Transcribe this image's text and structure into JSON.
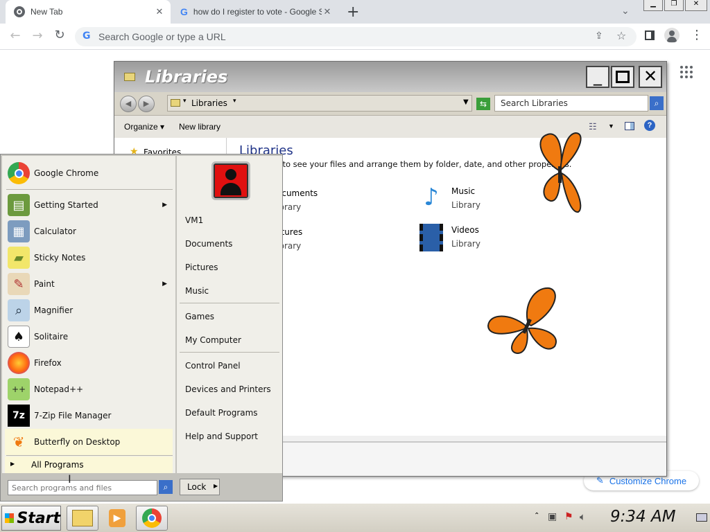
{
  "browser": {
    "tabs": [
      {
        "title": "New Tab",
        "active": true
      },
      {
        "title": "how do I register to vote - Google S",
        "active": false
      }
    ],
    "new_tab_symbol": "+",
    "omnibox_placeholder": "Search Google or type a URL",
    "customize_label": "Customize Chrome"
  },
  "explorer": {
    "title": "Libraries",
    "address": "Libraries",
    "search_placeholder": "Search Libraries",
    "toolbar": {
      "organize": "Organize",
      "new_library": "New library"
    },
    "nav_favorites": "Favorites",
    "heading": "Libraries",
    "description": "y to see your files and arrange them by folder, date, and other properties.",
    "libraries": [
      {
        "name": "ocuments",
        "type": "ibrary"
      },
      {
        "name": "Music",
        "type": "Library"
      },
      {
        "name": "ctures",
        "type": "ibrary"
      },
      {
        "name": "Videos",
        "type": "Library"
      }
    ]
  },
  "start_menu": {
    "left_items": [
      {
        "label": "Google Chrome",
        "icon": "chrome-icon",
        "submenu": false
      },
      {
        "label": "Getting Started",
        "icon": "getting-started-icon",
        "submenu": true
      },
      {
        "label": "Calculator",
        "icon": "calculator-icon",
        "submenu": false
      },
      {
        "label": "Sticky Notes",
        "icon": "sticky-notes-icon",
        "submenu": false
      },
      {
        "label": "Paint",
        "icon": "paint-icon",
        "submenu": true
      },
      {
        "label": "Magnifier",
        "icon": "magnifier-icon",
        "submenu": false
      },
      {
        "label": "Solitaire",
        "icon": "solitaire-icon",
        "submenu": false
      },
      {
        "label": "Firefox",
        "icon": "firefox-icon",
        "submenu": false
      },
      {
        "label": "Notepad++",
        "icon": "notepadpp-icon",
        "submenu": false
      },
      {
        "label": "7-Zip File Manager",
        "icon": "7zip-icon",
        "submenu": false
      },
      {
        "label": "Butterfly on Desktop",
        "icon": "butterfly-icon",
        "submenu": false
      }
    ],
    "all_programs": "All Programs",
    "search_placeholder": "Search programs and files",
    "right_items": [
      "VM1",
      "Documents",
      "Pictures",
      "Music",
      "Games",
      "My Computer",
      "Control Panel",
      "Devices and Printers",
      "Default Programs",
      "Help and Support"
    ],
    "lock_label": "Lock"
  },
  "taskbar": {
    "start_label": "Start",
    "clock": "9:34 AM"
  },
  "colors": {
    "butterfly_orange": "#f07a10",
    "chrome_red": "#ea4335",
    "chrome_green": "#34a853",
    "chrome_yellow": "#fbbc05",
    "chrome_blue": "#4285f4"
  }
}
